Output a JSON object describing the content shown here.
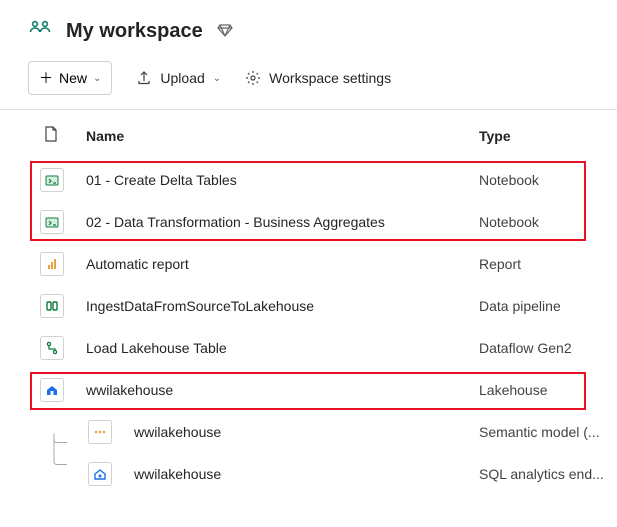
{
  "header": {
    "title": "My workspace"
  },
  "toolbar": {
    "new_label": "New",
    "upload_label": "Upload",
    "settings_label": "Workspace settings"
  },
  "columns": {
    "name": "Name",
    "type": "Type"
  },
  "items": [
    {
      "name": "01 - Create Delta Tables",
      "type": "Notebook",
      "icon": "notebook"
    },
    {
      "name": "02 - Data Transformation - Business Aggregates",
      "type": "Notebook",
      "icon": "notebook"
    },
    {
      "name": "Automatic report",
      "type": "Report",
      "icon": "report"
    },
    {
      "name": "IngestDataFromSourceToLakehouse",
      "type": "Data pipeline",
      "icon": "pipeline"
    },
    {
      "name": "Load Lakehouse Table",
      "type": "Dataflow Gen2",
      "icon": "dataflow"
    },
    {
      "name": "wwilakehouse",
      "type": "Lakehouse",
      "icon": "lakehouse"
    }
  ],
  "children": [
    {
      "name": "wwilakehouse",
      "type": "Semantic model (...",
      "icon": "semantic"
    },
    {
      "name": "wwilakehouse",
      "type": "SQL analytics end...",
      "icon": "sql"
    }
  ]
}
